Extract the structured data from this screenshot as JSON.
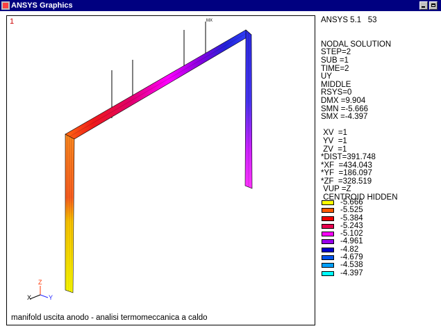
{
  "window": {
    "title": "ANSYS Graphics"
  },
  "viewport": {
    "window_number": "1",
    "mx_label": "MX",
    "caption": "manifold uscita anodo - analisi termomeccanica a caldo",
    "triad": {
      "z": "Z",
      "x": "X",
      "y": "Y"
    }
  },
  "info": {
    "version": "ANSYS 5.1   53",
    "lines": [
      "NODAL SOLUTION",
      "STEP=2",
      "SUB =1",
      "TIME=2",
      "UY",
      "MIDDLE",
      "RSYS=0",
      "DMX =9.904",
      "SMN =-5.666",
      "SMX =-4.397"
    ],
    "view_lines": [
      " XV  =1",
      " YV  =1",
      " ZV  =1",
      "*DIST=391.748",
      "*XF  =434.043",
      "*YF  =186.097",
      "*ZF  =328.519",
      " VUP =Z",
      " CENTROID HIDDEN"
    ]
  },
  "legend": [
    {
      "value": "-5.666",
      "color": "#ffff00"
    },
    {
      "value": "-5.525",
      "color": "#ff5a00"
    },
    {
      "value": "-5.384",
      "color": "#ee0000"
    },
    {
      "value": "-5.243",
      "color": "#e8004e"
    },
    {
      "value": "-5.102",
      "color": "#ff00ff"
    },
    {
      "value": "-4.961",
      "color": "#9900ee"
    },
    {
      "value": "-4.82",
      "color": "#0000cc"
    },
    {
      "value": "-4.679",
      "color": "#0055ee"
    },
    {
      "value": "-4.538",
      "color": "#00a0ff"
    },
    {
      "value": "-4.397",
      "color": "#00ffff"
    }
  ]
}
